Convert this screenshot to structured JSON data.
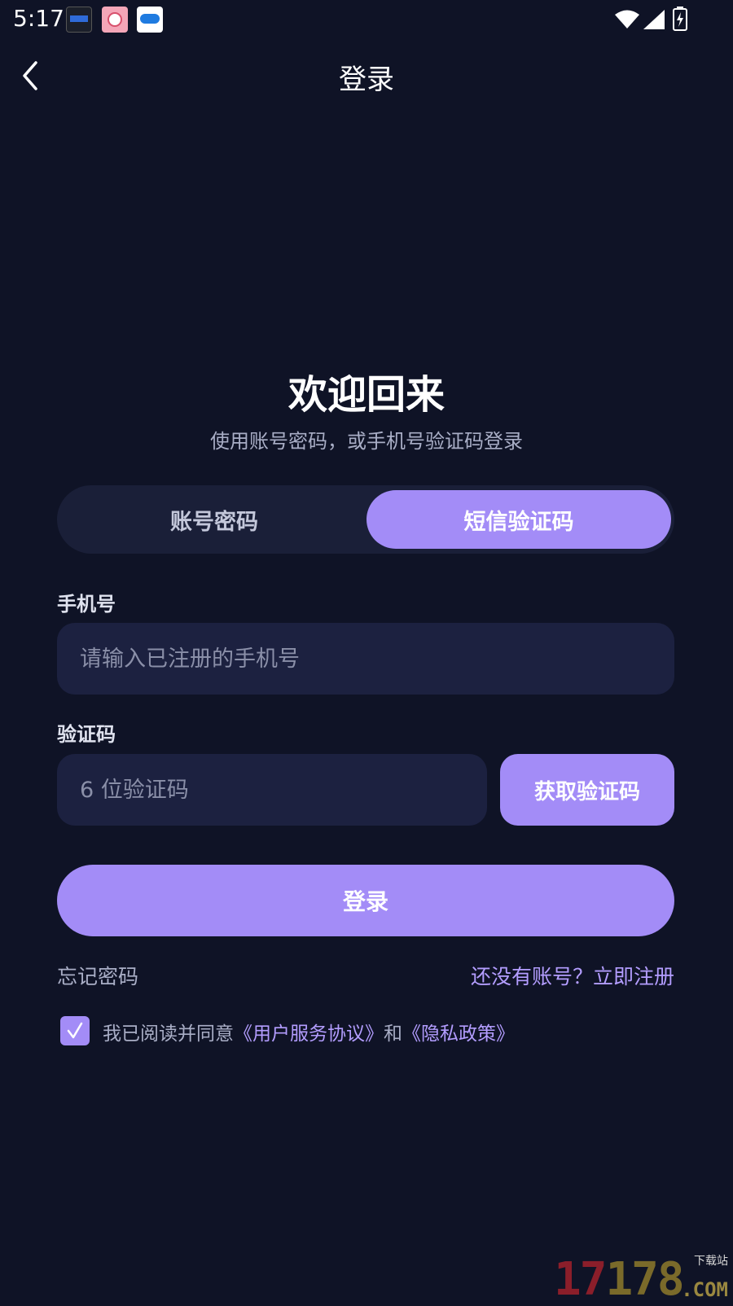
{
  "status_bar": {
    "time": "5:17",
    "icons": [
      "clock-widget-icon",
      "app-notification-icon",
      "app-notification-icon",
      "wifi-icon",
      "signal-icon",
      "battery-charging-icon"
    ]
  },
  "header": {
    "title": "登录",
    "back_icon": "chevron-left-icon"
  },
  "welcome": {
    "title": "欢迎回来",
    "subtitle": "使用账号密码，或手机号验证码登录"
  },
  "tabs": [
    {
      "label": "账号密码",
      "active": false
    },
    {
      "label": "短信验证码",
      "active": true
    }
  ],
  "form": {
    "phone_label": "手机号",
    "phone_placeholder": "请输入已注册的手机号",
    "phone_value": "",
    "code_label": "验证码",
    "code_placeholder": "6 位验证码",
    "code_value": "",
    "get_code_label": "获取验证码",
    "login_label": "登录"
  },
  "links": {
    "forgot": "忘记密码",
    "register": "还没有账号？立即注册"
  },
  "agreement": {
    "checked": true,
    "prefix": "我已阅读并同意",
    "terms": "《用户服务协议》",
    "conjunction": "和",
    "privacy": "《隐私政策》"
  },
  "watermark": {
    "digits_a": "17",
    "digits_b": "178",
    "site": "下载站",
    "com": ".COM"
  },
  "colors": {
    "background": "#0f1326",
    "accent": "#a38cf7",
    "input_bg": "#1c2140",
    "link": "#b39dff"
  }
}
